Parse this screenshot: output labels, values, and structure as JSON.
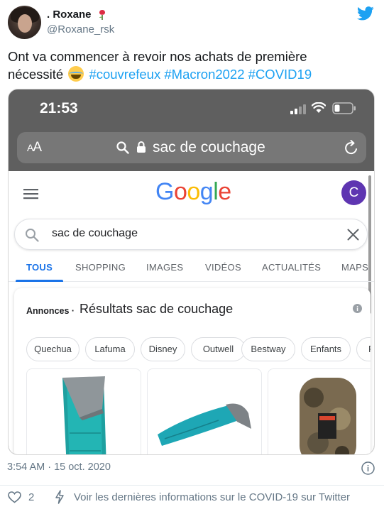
{
  "author": {
    "name": ". Roxane",
    "handle": "@Roxane_rsk"
  },
  "tweet": {
    "text_line1": "Ont va commencer à revoir nos achats de première",
    "text_line2": "nécessité",
    "hashtags": [
      "#couvrefeux",
      "#Macron2022",
      "#COVID19"
    ]
  },
  "screenshot": {
    "status_time": "21:53",
    "url_bar": {
      "aa_small": "A",
      "aa_large": "A",
      "url": "sac de couchage"
    },
    "google": {
      "logo_letters": [
        "G",
        "o",
        "o",
        "g",
        "l",
        "e"
      ],
      "logo_colors": [
        "#4285f4",
        "#ea4335",
        "#fbbc05",
        "#4285f4",
        "#34a853",
        "#ea4335"
      ],
      "account_initial": "C",
      "search_value": "sac de couchage",
      "tabs": [
        "TOUS",
        "SHOPPING",
        "IMAGES",
        "VIDÉOS",
        "ACTUALITÉS",
        "MAPS"
      ],
      "active_tab": "TOUS",
      "ads_label": "Annonces ·",
      "ads_title": "Résultats sac de couchage",
      "chips": [
        "Quechua",
        "Lafuma",
        "Disney",
        "Outwell",
        "Bestway",
        "Enfants",
        "Fe"
      ]
    }
  },
  "meta": {
    "timestamp": "3:54 AM · 15 oct. 2020",
    "like_count": "2",
    "info_link": "Voir les dernières informations sur le COVID-19 sur Twitter"
  },
  "colors": {
    "twitter_blue": "#1da1f2",
    "google_blue": "#1a73e8",
    "account_purple": "#5e35b1"
  }
}
